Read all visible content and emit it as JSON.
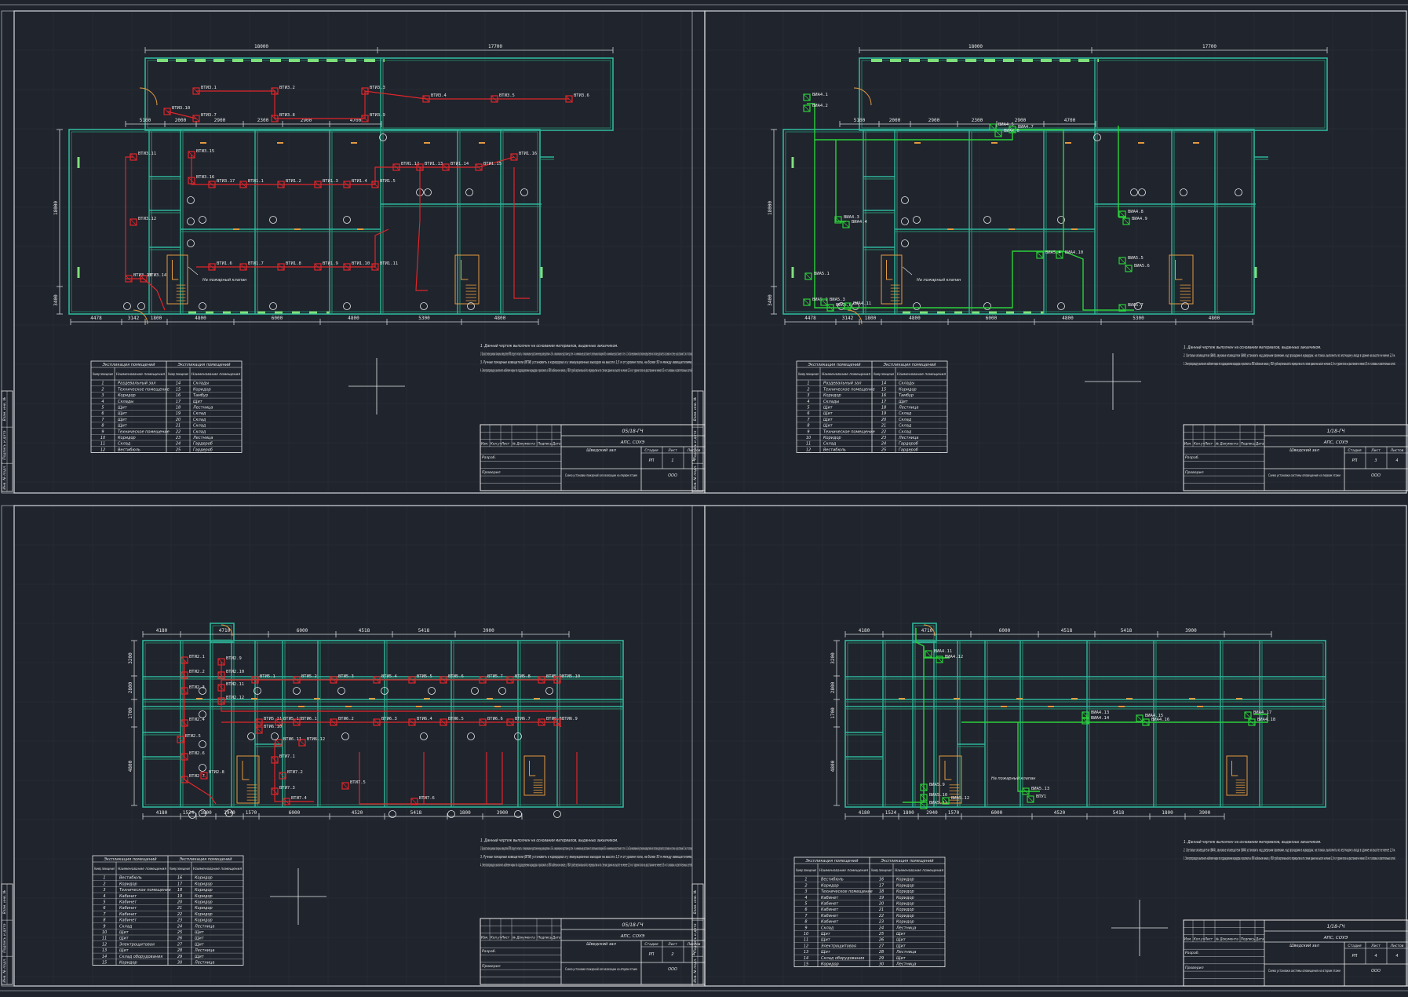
{
  "drawing": {
    "sheets": [
      {
        "id": "s1",
        "plan": {
          "dims_top": [
            "18000",
            "17700"
          ],
          "dims_mid": [
            "5100",
            "2000",
            "2900",
            "2300",
            "2900",
            "4700"
          ],
          "dims_bottom": [
            "4478",
            "3142",
            "1800",
            "4800",
            "6000",
            "4800",
            "5300",
            "4800"
          ],
          "dims_left": [
            "18000",
            "3400"
          ],
          "door_note": "На пожарный клапан",
          "devices": [
            "ВТИ3.1",
            "ВТИ3.2",
            "ВТИ3.3",
            "ВТИ3.4",
            "ВТИ3.5",
            "ВТИ3.6",
            "ВТИ3.7",
            "ВТИ3.8",
            "ВТИ3.9",
            "ВТИ3.10",
            "ВТИ3.11",
            "ВТИ3.12",
            "ВТИ3.13",
            "ВТИ3.14",
            "ВТИ3.15",
            "ВТИ3.16",
            "ВТИ3.17",
            "ВТИ1.1",
            "ВТИ1.2",
            "ВТИ1.3",
            "ВТИ1.4",
            "ВТИ1.5",
            "ВТИ1.6",
            "ВТИ1.7",
            "ВТИ1.8",
            "ВТИ1.9",
            "ВТИ1.10",
            "ВТИ1.11",
            "ВТИ1.12",
            "ВТИ1.13",
            "ВТИ1.14",
            "ВТИ1.15",
            "ВТИ1.16"
          ]
        },
        "notes": [
          "1. Данный чертеж выполнен на основании материалов, выданных заказчиком.",
          "2. При расстановке дымовых пожарных извещателей (ВТИ) следует учитывать, что максимальное расстояние между извещателями - 8,5 м, а максимальное расстояние до стен - 4 м, минимальное расстояние от светильников пожарной 0,5 м, минимальное расстояние от стен - 0,1 м. При невозможной установке извещателей на потолке допускается установка на стене, на расстоянии 0,1 м от потолка.",
          "3. Ручные пожарные извещатели (ВПИ) установить в коридорах и у эвакуационных выходов на высоте 1,5 м от уровня пола, на более 50 м между извещателями.",
          "4. Электропроводку выполнить кабелем марки по подразделению коридора и проложить в ПВХ кабельном канале, у ПВХ трубе вертикальной по перекрытию и по стенам здания на высоте не менее 2,5 м от уровня пола на расстоянии не менее 0,5 м от силовых и осветительных сетей."
        ],
        "legend": {
          "header": [
            "Экспликация помещений",
            "Экспликация помещений"
          ],
          "cols": [
            "Номер помещения",
            "Наименование помещения",
            "Номер помещения",
            "Наименование помещения"
          ],
          "rows": [
            [
              "1",
              "Раздевальный зал",
              "14",
              "Склады"
            ],
            [
              "2",
              "Техническое помещение",
              "15",
              "Коридор"
            ],
            [
              "3",
              "Коридор",
              "16",
              "Тамбур"
            ],
            [
              "4",
              "Склады",
              "17",
              "Щит"
            ],
            [
              "5",
              "Щит",
              "18",
              "Лестница"
            ],
            [
              "6",
              "Щит",
              "19",
              "Склад"
            ],
            [
              "7",
              "Щит",
              "20",
              "Склад"
            ],
            [
              "8",
              "Щит",
              "21",
              "Склад"
            ],
            [
              "9",
              "Техническое помещение",
              "22",
              "Склад"
            ],
            [
              "10",
              "Коридор",
              "23",
              "Лестница"
            ],
            [
              "11",
              "Склад",
              "24",
              "Гардероб"
            ],
            [
              "12",
              "Вестибюль",
              "25",
              "Гардероб"
            ]
          ]
        },
        "title_block": {
          "code": "05/18-ГЧ",
          "org": "АПС, СОУЭ",
          "stage_h": [
            "Стадия",
            "Лист",
            "Листов"
          ],
          "stage_v": [
            "РП",
            "1",
            "4"
          ],
          "building": "Шведский зал",
          "sheet_name": "Схема установки пожарной сигнализации на первом этаже",
          "firm": "ООО",
          "roles": [
            "Разраб.",
            "Проверил"
          ],
          "hdr": [
            "Изм.",
            "Кол.уч",
            "Лист",
            "№ Документа",
            "Подпись",
            "Дата"
          ]
        }
      },
      {
        "id": "s2",
        "plan": {
          "dims_top": [
            "18000",
            "17700"
          ],
          "dims_mid": [
            "5100",
            "2000",
            "2900",
            "2300",
            "2900",
            "4700"
          ],
          "dims_bottom": [
            "4478",
            "3142",
            "1800",
            "4800",
            "6000",
            "4800",
            "5300",
            "4800"
          ],
          "dims_left": [
            "18000",
            "3400"
          ],
          "door_note": "На пожарный клапан",
          "devices": [
            "ВИА4.1",
            "ВИА4.2",
            "ВИА4.3",
            "ВИА4.4",
            "ВИА4.5",
            "ВИА4.6",
            "ВИА4.7",
            "ВИА4.8",
            "ВИА4.9",
            "ВИА4.10",
            "ВИА5.1",
            "ВИА5.2",
            "ВИА5.3",
            "ВИА5.4",
            "ВИА5.5",
            "ВИА5.6",
            "ВИА5.7",
            "ВИА5.8",
            "ВИА4.11"
          ]
        },
        "notes": [
          "1. Данный чертеж выполнен на основании материалов, выданных заказчиком.",
          "2. Световые оповещатели (ВИА), звуковые оповещатели (ВИА) установить над дверными проемами, над проходами в коридорах, на этажах, выполнить по лестницам у входа в здание на высоте не менее 2,3 м.",
          "3. Электропроводку выполнить кабелем марки по подразделению коридора и проложить в ПВХ кабельном канале, у ПВХ трубе вертикальной по перекрытию и по стенам здания на высоте не менее 2,5 м от уровня пола на расстоянии не менее 0,5 м от силовых и осветительных сетей."
        ],
        "legend": {
          "header": [
            "Экспликация помещений",
            "Экспликация помещений"
          ],
          "cols": [
            "Номер помещения",
            "Наименование помещения",
            "Номер помещения",
            "Наименование помещения"
          ],
          "rows": [
            [
              "1",
              "Раздевальный зал",
              "14",
              "Склады"
            ],
            [
              "2",
              "Техническое помещение",
              "15",
              "Коридор"
            ],
            [
              "3",
              "Коридор",
              "16",
              "Тамбур"
            ],
            [
              "4",
              "Склады",
              "17",
              "Щит"
            ],
            [
              "5",
              "Щит",
              "18",
              "Лестница"
            ],
            [
              "6",
              "Щит",
              "19",
              "Склад"
            ],
            [
              "7",
              "Щит",
              "20",
              "Склад"
            ],
            [
              "8",
              "Щит",
              "21",
              "Склад"
            ],
            [
              "9",
              "Техническое помещение",
              "22",
              "Склад"
            ],
            [
              "10",
              "Коридор",
              "23",
              "Лестница"
            ],
            [
              "11",
              "Склад",
              "24",
              "Гардероб"
            ],
            [
              "12",
              "Вестибюль",
              "25",
              "Гардероб"
            ]
          ]
        },
        "title_block": {
          "code": "1/18-ГЧ",
          "org": "АПС, СОУЭ",
          "stage_h": [
            "Стадия",
            "Лист",
            "Листов"
          ],
          "stage_v": [
            "РП",
            "3",
            "4"
          ],
          "building": "Шведский зал",
          "sheet_name": "Схема установки системы оповещения на первом этаже",
          "firm": "ООО",
          "roles": [
            "Разраб.",
            "Проверил"
          ],
          "hdr": [
            "Изм.",
            "Кол.уч",
            "Лист",
            "№ Документа",
            "Подпись",
            "Дата"
          ]
        }
      },
      {
        "id": "s3",
        "plan": {
          "dims_top": [
            "4180",
            "4710",
            "6000",
            "4518",
            "5418",
            "3900"
          ],
          "dims_bottom": [
            "4180",
            "1524",
            "1800",
            "2940",
            "1570",
            "6000",
            "4520",
            "5418",
            "1800",
            "3900"
          ],
          "dims_left": [
            "3200",
            "2800",
            "1700",
            "4800"
          ],
          "devices": [
            "ВТИ2.1",
            "ВТИ2.2",
            "ВТИ2.3",
            "ВТИ2.4",
            "ВТИ2.5",
            "ВТИ2.6",
            "ВТИ2.7",
            "ВТИ2.8",
            "ВТИ2.9",
            "ВТИ2.10",
            "ВТИ2.11",
            "ВТИ2.12",
            "ВТИ5.1",
            "ВТИ5.2",
            "ВТИ5.3",
            "ВТИ5.4",
            "ВТИ5.5",
            "ВТИ5.6",
            "ВТИ5.7",
            "ВТИ5.8",
            "ВТИ5.9",
            "ВТИ5.10",
            "ВТИ5.11",
            "ВТИ5.12",
            "ВТИ6.1",
            "ВТИ6.2",
            "ВТИ6.3",
            "ВТИ6.4",
            "ВТИ6.5",
            "ВТИ6.6",
            "ВТИ6.7",
            "ВТИ6.8",
            "ВТИ6.9",
            "ВТИ6.10",
            "ВТИ6.11",
            "ВТИ6.12",
            "ВТИ7.1",
            "ВТИ7.2",
            "ВТИ7.3",
            "ВТИ7.4",
            "ВТИ7.5",
            "ВТИ7.6",
            "ВТИ7.7",
            "ВТИ7.8"
          ]
        },
        "notes": [
          "1. Данный чертеж выполнен на основании материалов, выданных заказчиком.",
          "2. При расстановке дымовых пожарных извещателей (ВТИ) следует учитывать, что максимальное расстояние между извещателями - 8,5 м, а максимальное расстояние до стен - 4 м, минимальное расстояние от светильников пожарной 0,5 м, минимальное расстояние от стен - 0,1 м. При невозможной установке извещателей на потолке допускается установка на стене, на расстоянии 0,1 м от потолка.",
          "3. Ручные пожарные извещатели (ВПИ) установить в коридорах и у эвакуационных выходов на высоте 1,5 м от уровня пола, не более 50 м между извещателями.",
          "4. Электропроводку выполнить кабелем марки по подразделению коридора и проложить в ПВХ кабельном канале, у ПВХ трубе вертикальной по перекрытию и по стенам здания на высоте не менее 2,5 м от уровня пола на расстоянии не менее 0,5 м от силовых и осветительных сетей."
        ],
        "legend": {
          "header": [
            "Экспликация помещений",
            "Экспликация помещений"
          ],
          "cols": [
            "Номер помещения",
            "Наименование помещения",
            "Номер помещения",
            "Наименование помещения"
          ],
          "rows": [
            [
              "1",
              "Вестибюль",
              "16",
              "Коридор"
            ],
            [
              "2",
              "Коридор",
              "17",
              "Коридор"
            ],
            [
              "3",
              "Техническое помещение",
              "18",
              "Коридор"
            ],
            [
              "4",
              "Кабинет",
              "19",
              "Коридор"
            ],
            [
              "5",
              "Кабинет",
              "20",
              "Коридор"
            ],
            [
              "6",
              "Кабинет",
              "21",
              "Коридор"
            ],
            [
              "7",
              "Кабинет",
              "22",
              "Коридор"
            ],
            [
              "8",
              "Кабинет",
              "23",
              "Коридор"
            ],
            [
              "9",
              "Склад",
              "24",
              "Лестница"
            ],
            [
              "10",
              "Щит",
              "25",
              "Щит"
            ],
            [
              "11",
              "Щит",
              "26",
              "Щит"
            ],
            [
              "12",
              "Электрощитовая",
              "27",
              "Щит"
            ],
            [
              "13",
              "Щит",
              "28",
              "Лестница"
            ],
            [
              "14",
              "Склад оборудования",
              "29",
              "Щит"
            ],
            [
              "15",
              "Коридор",
              "30",
              "Лестница"
            ]
          ]
        },
        "title_block": {
          "code": "05/18-ГЧ",
          "org": "АПС, СОУЭ",
          "stage_h": [
            "Стадия",
            "Лист",
            "Листов"
          ],
          "stage_v": [
            "РП",
            "2",
            "4"
          ],
          "building": "Шведский зал",
          "sheet_name": "Схема установки пожарной сигнализации на втором этаже",
          "firm": "ООО",
          "roles": [
            "Разраб.",
            "Проверил"
          ],
          "hdr": [
            "Изм.",
            "Кол.уч",
            "Лист",
            "№ Документа",
            "Подпись",
            "Дата"
          ]
        }
      },
      {
        "id": "s4",
        "plan": {
          "dims_top": [
            "4180",
            "4710",
            "6000",
            "4518",
            "5418",
            "3900"
          ],
          "dims_bottom": [
            "4180",
            "1524",
            "1800",
            "2940",
            "1570",
            "6000",
            "4520",
            "5418",
            "1800",
            "3900"
          ],
          "dims_left": [
            "3200",
            "2800",
            "1700",
            "4800"
          ],
          "door_note": "На пожарный клапан",
          "devices": [
            "ВИА4.11",
            "ВИА4.12",
            "ВИА4.13",
            "ВИА4.14",
            "ВИА4.15",
            "ВИА4.16",
            "ВИА4.17",
            "ВИА4.18",
            "ВИА5.9",
            "ВИА5.10",
            "ВИА5.11",
            "ВИА5.12",
            "ВИА5.13",
            "ВПУ1"
          ]
        },
        "notes": [
          "1. Данный чертеж выполнен на основании материалов, выданных заказчиком.",
          "2. Световые оповещатели (ВИА), звуковые оповещатели (ВИА) установить над дверными проемами, над проходами в коридорах, на этажах, выполнить по лестницам у входа в здание на высоте не менее 2,3 м.",
          "3. Электропроводку выполнить кабелем марки по подразделению коридора и проложить в ПВХ кабельном канале, у ПВХ трубе вертикальной по перекрытию и по стенам здания на высоте не менее 2,5 м от уровня пола на расстоянии не менее 0,5 м от силовых и осветительных сетей."
        ],
        "legend": {
          "header": [
            "Экспликация помещений",
            "Экспликация помещений"
          ],
          "cols": [
            "Номер помещения",
            "Наименование помещения",
            "Номер помещения",
            "Наименование помещения"
          ],
          "rows": [
            [
              "1",
              "Вестибюль",
              "16",
              "Коридор"
            ],
            [
              "2",
              "Коридор",
              "17",
              "Коридор"
            ],
            [
              "3",
              "Техническое помещение",
              "18",
              "Коридор"
            ],
            [
              "4",
              "Кабинет",
              "19",
              "Коридор"
            ],
            [
              "5",
              "Кабинет",
              "20",
              "Коридор"
            ],
            [
              "6",
              "Кабинет",
              "21",
              "Коридор"
            ],
            [
              "7",
              "Кабинет",
              "22",
              "Коридор"
            ],
            [
              "8",
              "Кабинет",
              "23",
              "Коридор"
            ],
            [
              "9",
              "Склад",
              "24",
              "Лестница"
            ],
            [
              "10",
              "Щит",
              "25",
              "Щит"
            ],
            [
              "11",
              "Щит",
              "26",
              "Щит"
            ],
            [
              "12",
              "Электрощитовая",
              "27",
              "Щит"
            ],
            [
              "13",
              "Щит",
              "28",
              "Лестница"
            ],
            [
              "14",
              "Склад оборудования",
              "29",
              "Щит"
            ],
            [
              "15",
              "Коридор",
              "30",
              "Лестница"
            ]
          ]
        },
        "title_block": {
          "code": "1/18-ГЧ",
          "org": "АПС, СОУЭ",
          "stage_h": [
            "Стадия",
            "Лист",
            "Листов"
          ],
          "stage_v": [
            "РП",
            "4",
            "4"
          ],
          "building": "Шведский зал",
          "sheet_name": "Схема установки системы оповещения на втором этаже",
          "firm": "ООО",
          "roles": [
            "Разраб.",
            "Проверил"
          ],
          "hdr": [
            "Изм.",
            "Кол.уч",
            "Лист",
            "№ Документа",
            "Подпись",
            "Дата"
          ]
        }
      }
    ],
    "side_stamp": [
      "Взам. инв. №",
      "Подпись и дата",
      "Инв. № подл."
    ]
  }
}
